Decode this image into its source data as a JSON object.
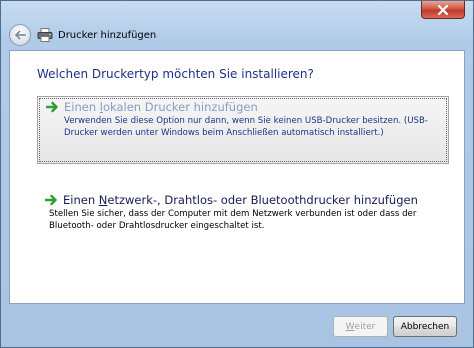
{
  "window": {
    "title": "Drucker hinzufügen",
    "close_icon": "close-icon",
    "back_icon": "back-arrow-icon",
    "title_icon": "printer-icon"
  },
  "heading": "Welchen Druckertyp möchten Sie installieren?",
  "options": [
    {
      "title_pre": "Einen ",
      "title_acc": "l",
      "title_post": "okalen Drucker hinzufügen",
      "description": "Verwenden Sie diese Option nur dann, wenn Sie keinen USB-Drucker besitzen. (USB-Drucker werden unter Windows beim Anschließen automatisch installiert.)",
      "selected": true,
      "icon": "green-arrow-icon"
    },
    {
      "title_pre": "Einen ",
      "title_acc": "N",
      "title_post": "etzwerk-, Drahtlos- oder Bluetoothdrucker hinzufügen",
      "description": "Stellen Sie sicher, dass der Computer mit dem Netzwerk verbunden ist oder dass der Bluetooth- oder Drahtlosdrucker eingeschaltet ist.",
      "selected": false,
      "icon": "green-arrow-icon"
    }
  ],
  "buttons": {
    "next_acc": "W",
    "next_rest": "eiter",
    "next_enabled": false,
    "cancel_label": "Abbrechen"
  },
  "colors": {
    "heading": "#1e3287",
    "accent_green": "#2e9c2e",
    "close_red": "#c0392b"
  }
}
